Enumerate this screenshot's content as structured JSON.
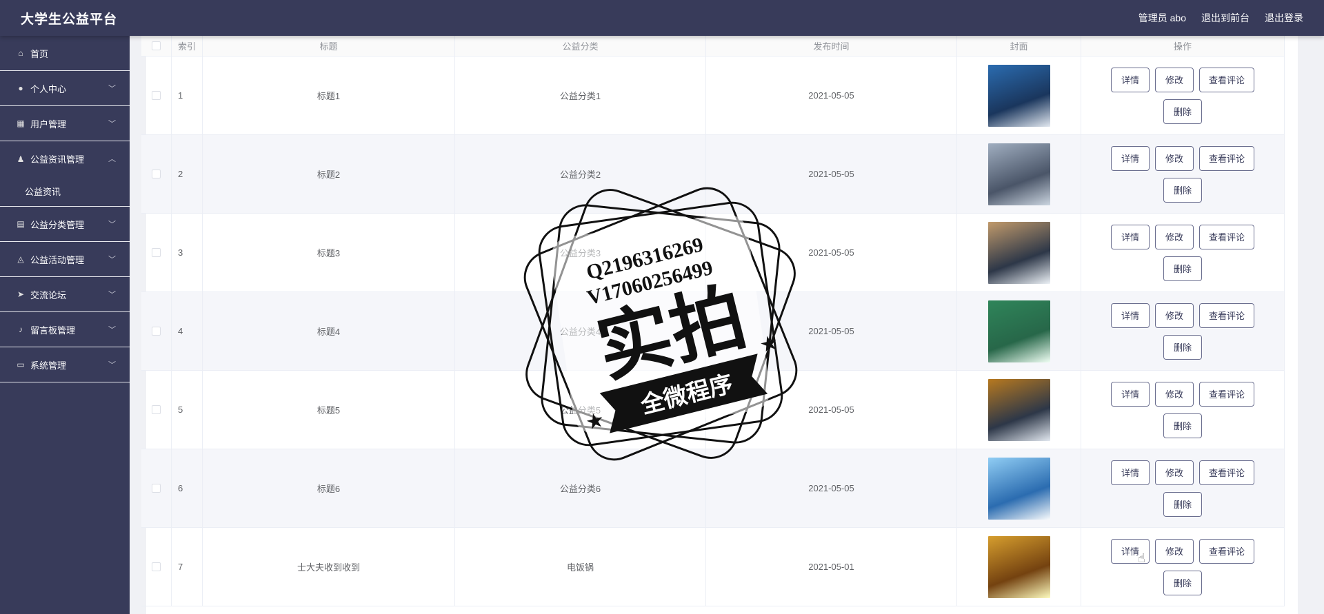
{
  "app": {
    "title": "大学生公益平台"
  },
  "top_links": [
    "管理员 abo",
    "退出到前台",
    "退出登录"
  ],
  "sidebar": {
    "items": [
      {
        "label": "首页",
        "icon": "home-icon",
        "chev": ""
      },
      {
        "label": "个人中心",
        "icon": "user-icon",
        "chev": "﹀"
      },
      {
        "label": "用户管理",
        "icon": "grid-icon",
        "chev": "﹀"
      },
      {
        "label": "公益资讯管理",
        "icon": "person-icon",
        "chev": "︿",
        "open": true,
        "children": [
          "公益资讯"
        ]
      },
      {
        "label": "公益分类管理",
        "icon": "clipboard-icon",
        "chev": "﹀"
      },
      {
        "label": "公益活动管理",
        "icon": "bell-icon",
        "chev": "﹀"
      },
      {
        "label": "交流论坛",
        "icon": "send-icon",
        "chev": "﹀"
      },
      {
        "label": "留言板管理",
        "icon": "mic-icon",
        "chev": "﹀"
      },
      {
        "label": "系统管理",
        "icon": "message-icon",
        "chev": "﹀"
      }
    ]
  },
  "table": {
    "headers": {
      "index": "索引",
      "title": "标题",
      "category": "公益分类",
      "date": "发布时间",
      "cover": "封面",
      "ops": "操作"
    },
    "rows": [
      {
        "index": "1",
        "title": "标题1",
        "category": "公益分类1",
        "date": "2021-05-05"
      },
      {
        "index": "2",
        "title": "标题2",
        "category": "公益分类2",
        "date": "2021-05-05"
      },
      {
        "index": "3",
        "title": "标题3",
        "category": "公益分类3",
        "date": "2021-05-05"
      },
      {
        "index": "4",
        "title": "标题4",
        "category": "公益分类4",
        "date": "2021-05-05"
      },
      {
        "index": "5",
        "title": "标题5",
        "category": "公益分类5",
        "date": "2021-05-05"
      },
      {
        "index": "6",
        "title": "标题6",
        "category": "公益分类6",
        "date": "2021-05-05"
      },
      {
        "index": "7",
        "title": "士大夫收到收到",
        "category": "电饭锅",
        "date": "2021-05-01"
      }
    ],
    "ops": {
      "detail": "详情",
      "edit": "修改",
      "comments": "查看评论",
      "delete": "删除"
    }
  },
  "watermark": {
    "line1": "Q2196316269",
    "line2": "V17060256499",
    "main": "实拍",
    "ribbon": "全微程序"
  },
  "colors": {
    "sidebar": "#383b5a",
    "accent": "#6a6e8f"
  }
}
